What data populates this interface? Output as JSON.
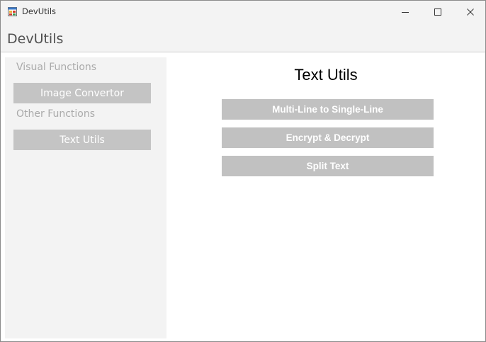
{
  "window": {
    "title": "DevUtils",
    "icon": "app-form-icon",
    "controls": [
      "minimize-icon",
      "maximize-icon",
      "close-icon"
    ]
  },
  "header": {
    "title": "DevUtils"
  },
  "sidebar": {
    "sections": [
      {
        "heading": "Visual Functions",
        "button": "Image Convertor"
      },
      {
        "heading": "Other Functions",
        "button": "Text Utils"
      }
    ]
  },
  "main": {
    "title": "Text Utils",
    "buttons": [
      "Multi-Line to Single-Line",
      "Encrypt & Decrypt",
      "Split Text"
    ]
  },
  "colors": {
    "chrome": "#f3f3f3",
    "button": "#c1c1c1",
    "button_text": "#ffffff",
    "muted_text": "#aaaaaa"
  }
}
